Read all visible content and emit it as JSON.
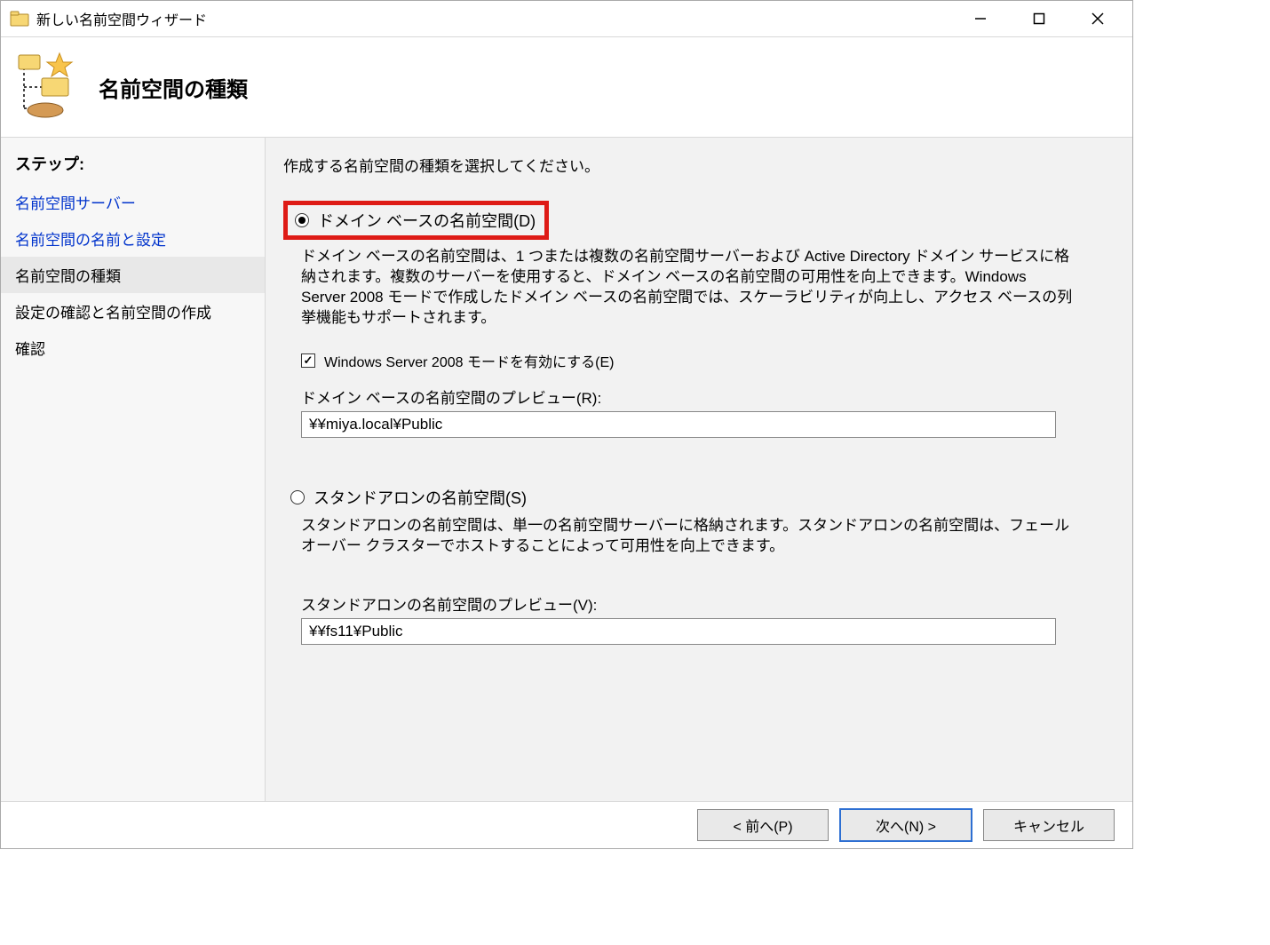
{
  "window": {
    "title": "新しい名前空間ウィザード"
  },
  "header": {
    "page_title": "名前空間の種類"
  },
  "sidebar": {
    "heading": "ステップ:",
    "items": [
      {
        "label": "名前空間サーバー",
        "state": "link"
      },
      {
        "label": "名前空間の名前と設定",
        "state": "link"
      },
      {
        "label": "名前空間の種類",
        "state": "current"
      },
      {
        "label": "設定の確認と名前空間の作成",
        "state": "future"
      },
      {
        "label": "確認",
        "state": "future"
      }
    ]
  },
  "content": {
    "intro": "作成する名前空間の種類を選択してください。",
    "domain_option": {
      "label": "ドメイン ベースの名前空間(D)",
      "selected": true,
      "description": "ドメイン ベースの名前空間は、1 つまたは複数の名前空間サーバーおよび Active Directory ドメイン サービスに格納されます。複数のサーバーを使用すると、ドメイン ベースの名前空間の可用性を向上できます。Windows Server 2008 モードで作成したドメイン ベースの名前空間では、スケーラビリティが向上し、アクセス ベースの列挙機能もサポートされます。"
    },
    "ws2008": {
      "label": "Windows Server 2008 モードを有効にする(E)",
      "checked": true
    },
    "domain_preview": {
      "label": "ドメイン ベースの名前空間のプレビュー(R):",
      "value": "¥¥miya.local¥Public"
    },
    "standalone_option": {
      "label": "スタンドアロンの名前空間(S)",
      "selected": false,
      "description": "スタンドアロンの名前空間は、単一の名前空間サーバーに格納されます。スタンドアロンの名前空間は、フェールオーバー クラスターでホストすることによって可用性を向上できます。"
    },
    "standalone_preview": {
      "label": "スタンドアロンの名前空間のプレビュー(V):",
      "value": "¥¥fs11¥Public"
    }
  },
  "footer": {
    "back": "< 前へ(P)",
    "next": "次へ(N) >",
    "cancel": "キャンセル"
  }
}
